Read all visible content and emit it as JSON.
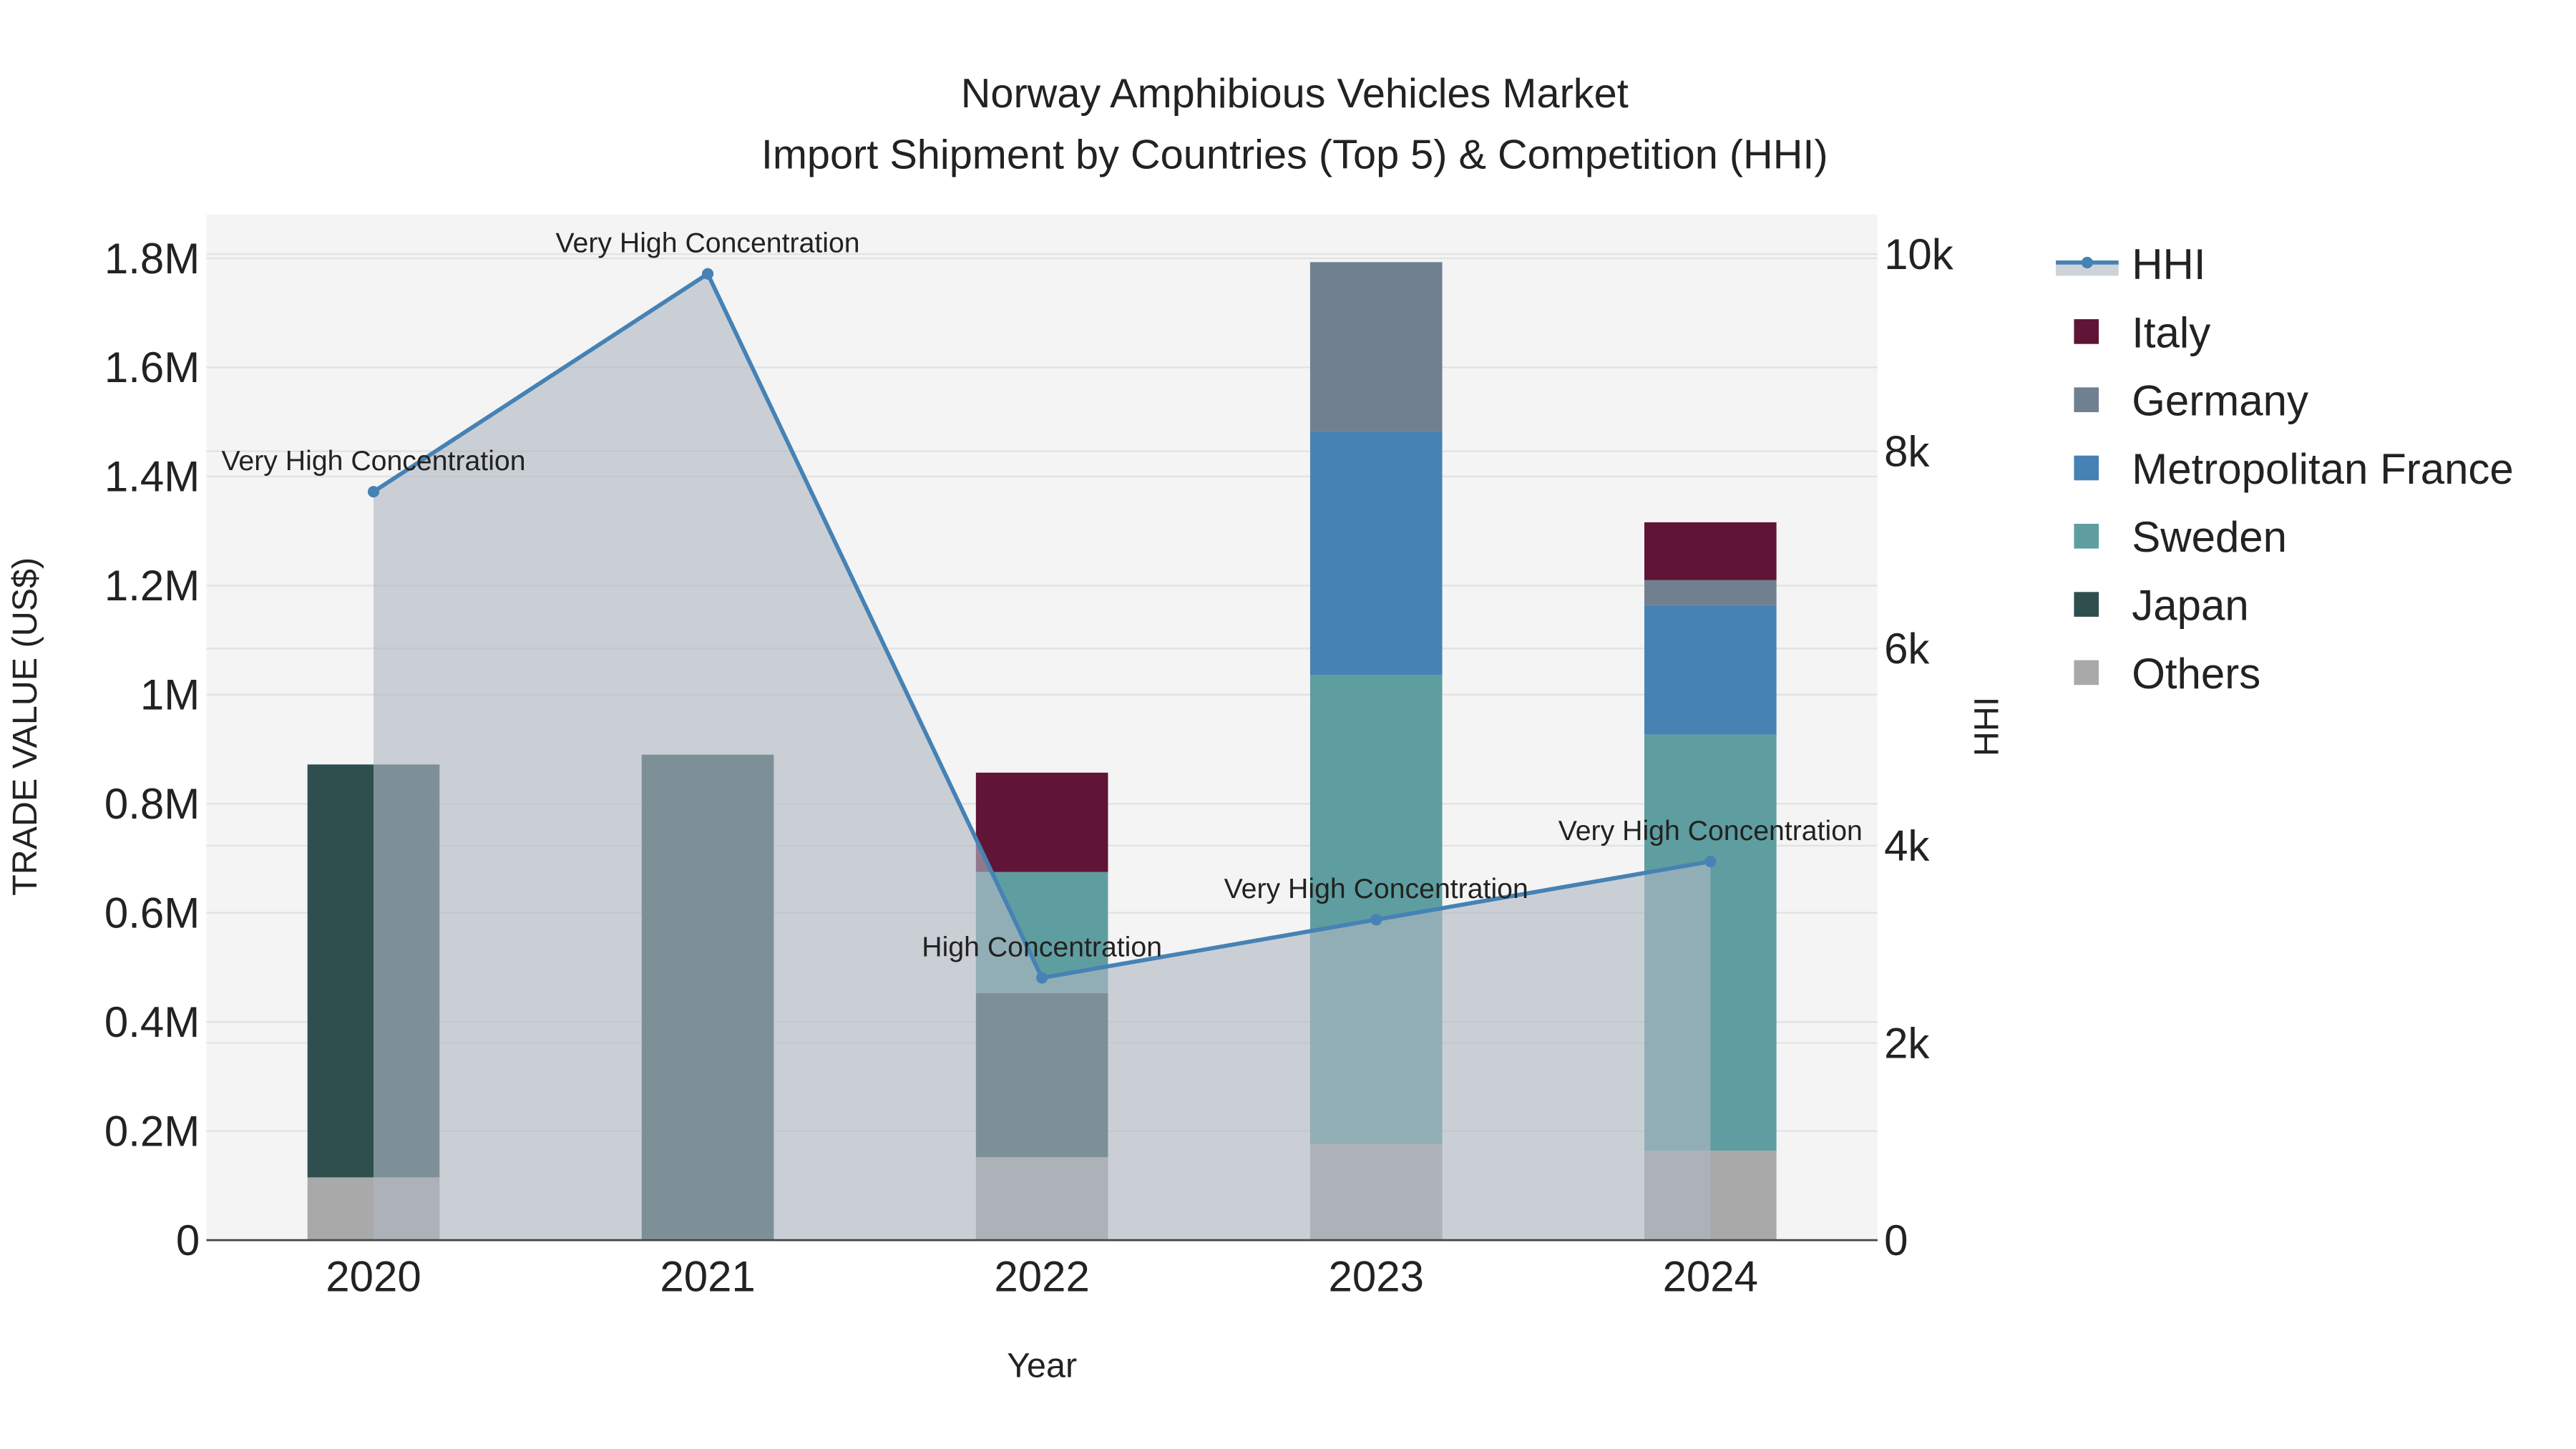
{
  "chart_data": {
    "type": "bar",
    "title_line1": "Norway Amphibious Vehicles Market",
    "title_line2": "Import Shipment by Countries (Top 5) & Competition (HHI)",
    "xlabel": "Year",
    "ylabel": "TRADE VALUE (US$)",
    "y2label": "HHI",
    "categories": [
      "2020",
      "2021",
      "2022",
      "2023",
      "2024"
    ],
    "ylim": [
      0,
      1880000
    ],
    "y_ticks": [
      0,
      200000,
      400000,
      600000,
      800000,
      1000000,
      1200000,
      1400000,
      1600000,
      1800000
    ],
    "y_tick_labels": [
      "0",
      "0.2M",
      "0.4M",
      "0.6M",
      "0.8M",
      "1M",
      "1.2M",
      "1.4M",
      "1.6M",
      "1.8M"
    ],
    "y2lim": [
      0,
      10400
    ],
    "y2_ticks": [
      0,
      2000,
      4000,
      6000,
      8000,
      10000
    ],
    "y2_tick_labels": [
      "0",
      "2k",
      "4k",
      "6k",
      "8k",
      "10k"
    ],
    "stacked": true,
    "series": [
      {
        "name": "Others",
        "color": "#A9A9A9",
        "values": [
          115000,
          0,
          152000,
          176000,
          164000
        ]
      },
      {
        "name": "Japan",
        "color": "#2F4F4F",
        "values": [
          757000,
          890000,
          301000,
          0,
          0
        ]
      },
      {
        "name": "Sweden",
        "color": "#5F9EA0",
        "values": [
          0,
          0,
          222000,
          860000,
          763000
        ]
      },
      {
        "name": "Metropolitan France",
        "color": "#4682B4",
        "values": [
          0,
          0,
          0,
          447000,
          237000
        ]
      },
      {
        "name": "Germany",
        "color": "#708090",
        "values": [
          0,
          0,
          0,
          310000,
          46000
        ]
      },
      {
        "name": "Italy",
        "color": "#601436",
        "values": [
          0,
          0,
          182000,
          0,
          106000
        ]
      }
    ],
    "hhi": {
      "name": "HHI",
      "color": "#4682B4",
      "values": [
        7590,
        9800,
        2660,
        3250,
        3840
      ],
      "annotations": [
        "Very High Concentration",
        "Very High Concentration",
        "High Concentration",
        "Very High Concentration",
        "Very High Concentration"
      ]
    },
    "legend_order": [
      "HHI",
      "Italy",
      "Germany",
      "Metropolitan France",
      "Sweden",
      "Japan",
      "Others"
    ],
    "legend_position": "right",
    "grid": true
  }
}
